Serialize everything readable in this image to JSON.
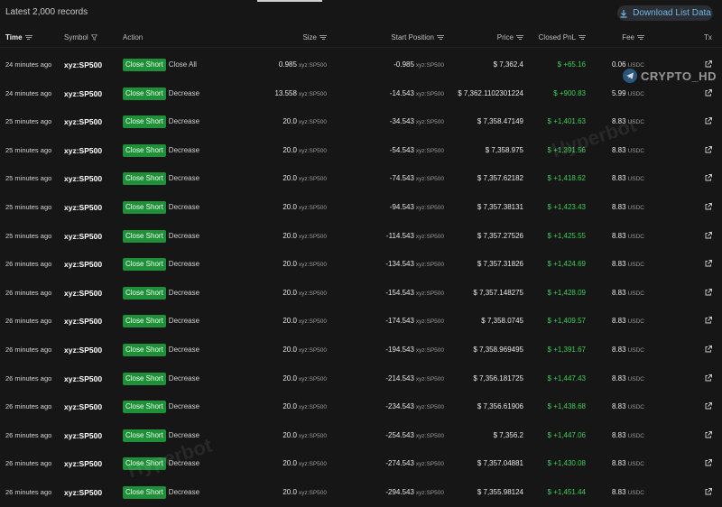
{
  "top": {
    "records_label": "Latest 2,000 records",
    "download_label": "Download List Data"
  },
  "columns": {
    "time": "Time",
    "symbol": "Symbol",
    "action": "Action",
    "size": "Size",
    "start_position": "Start Position",
    "price": "Price",
    "closed_pnl": "Closed PnL",
    "fee": "Fee",
    "tx": "Tx"
  },
  "watermark": {
    "brand": "CRYPTO_HD",
    "bot1": "Hyperbot",
    "bot2": "Hyperbot"
  },
  "unit_sym": "xyz:SP500",
  "unit_fee": "USDC",
  "rows": [
    {
      "time": "24 minutes ago",
      "symbol": "xyz:SP500",
      "badge": "Close Short",
      "detail": "Close All",
      "size": "0.985",
      "start": "-0.985",
      "price": "$ 7,362.4",
      "pnl": "$ +65.16",
      "fee": "0.06"
    },
    {
      "time": "24 minutes ago",
      "symbol": "xyz:SP500",
      "badge": "Close Short",
      "detail": "Decrease",
      "size": "13.558",
      "start": "-14.543",
      "price": "$ 7,362.1102301224",
      "pnl": "$ +900.83",
      "fee": "5.99"
    },
    {
      "time": "25 minutes ago",
      "symbol": "xyz:SP500",
      "badge": "Close Short",
      "detail": "Decrease",
      "size": "20.0",
      "start": "-34.543",
      "price": "$ 7,358.47149",
      "pnl": "$ +1,401.63",
      "fee": "8.83"
    },
    {
      "time": "25 minutes ago",
      "symbol": "xyz:SP500",
      "badge": "Close Short",
      "detail": "Decrease",
      "size": "20.0",
      "start": "-54.543",
      "price": "$ 7,358.975",
      "pnl": "$ +1,391.56",
      "fee": "8.83"
    },
    {
      "time": "25 minutes ago",
      "symbol": "xyz:SP500",
      "badge": "Close Short",
      "detail": "Decrease",
      "size": "20.0",
      "start": "-74.543",
      "price": "$ 7,357.62182",
      "pnl": "$ +1,418.62",
      "fee": "8.83"
    },
    {
      "time": "25 minutes ago",
      "symbol": "xyz:SP500",
      "badge": "Close Short",
      "detail": "Decrease",
      "size": "20.0",
      "start": "-94.543",
      "price": "$ 7,357.38131",
      "pnl": "$ +1,423.43",
      "fee": "8.83"
    },
    {
      "time": "25 minutes ago",
      "symbol": "xyz:SP500",
      "badge": "Close Short",
      "detail": "Decrease",
      "size": "20.0",
      "start": "-114.543",
      "price": "$ 7,357.27526",
      "pnl": "$ +1,425.55",
      "fee": "8.83"
    },
    {
      "time": "26 minutes ago",
      "symbol": "xyz:SP500",
      "badge": "Close Short",
      "detail": "Decrease",
      "size": "20.0",
      "start": "-134.543",
      "price": "$ 7,357.31826",
      "pnl": "$ +1,424.69",
      "fee": "8.83"
    },
    {
      "time": "26 minutes ago",
      "symbol": "xyz:SP500",
      "badge": "Close Short",
      "detail": "Decrease",
      "size": "20.0",
      "start": "-154.543",
      "price": "$ 7,357.148275",
      "pnl": "$ +1,428.09",
      "fee": "8.83"
    },
    {
      "time": "26 minutes ago",
      "symbol": "xyz:SP500",
      "badge": "Close Short",
      "detail": "Decrease",
      "size": "20.0",
      "start": "-174.543",
      "price": "$ 7,358.0745",
      "pnl": "$ +1,409.57",
      "fee": "8.83"
    },
    {
      "time": "26 minutes ago",
      "symbol": "xyz:SP500",
      "badge": "Close Short",
      "detail": "Decrease",
      "size": "20.0",
      "start": "-194.543",
      "price": "$ 7,358.969495",
      "pnl": "$ +1,391.67",
      "fee": "8.83"
    },
    {
      "time": "26 minutes ago",
      "symbol": "xyz:SP500",
      "badge": "Close Short",
      "detail": "Decrease",
      "size": "20.0",
      "start": "-214.543",
      "price": "$ 7,356.181725",
      "pnl": "$ +1,447.43",
      "fee": "8.83"
    },
    {
      "time": "26 minutes ago",
      "symbol": "xyz:SP500",
      "badge": "Close Short",
      "detail": "Decrease",
      "size": "20.0",
      "start": "-234.543",
      "price": "$ 7,356.61906",
      "pnl": "$ +1,438.68",
      "fee": "8.83"
    },
    {
      "time": "26 minutes ago",
      "symbol": "xyz:SP500",
      "badge": "Close Short",
      "detail": "Decrease",
      "size": "20.0",
      "start": "-254.543",
      "price": "$ 7,356.2",
      "pnl": "$ +1,447.06",
      "fee": "8.83"
    },
    {
      "time": "26 minutes ago",
      "symbol": "xyz:SP500",
      "badge": "Close Short",
      "detail": "Decrease",
      "size": "20.0",
      "start": "-274.543",
      "price": "$ 7,357.04881",
      "pnl": "$ +1,430.08",
      "fee": "8.83"
    },
    {
      "time": "26 minutes ago",
      "symbol": "xyz:SP500",
      "badge": "Close Short",
      "detail": "Decrease",
      "size": "20.0",
      "start": "-294.543",
      "price": "$ 7,355.98124",
      "pnl": "$ +1,451.44",
      "fee": "8.83"
    }
  ]
}
